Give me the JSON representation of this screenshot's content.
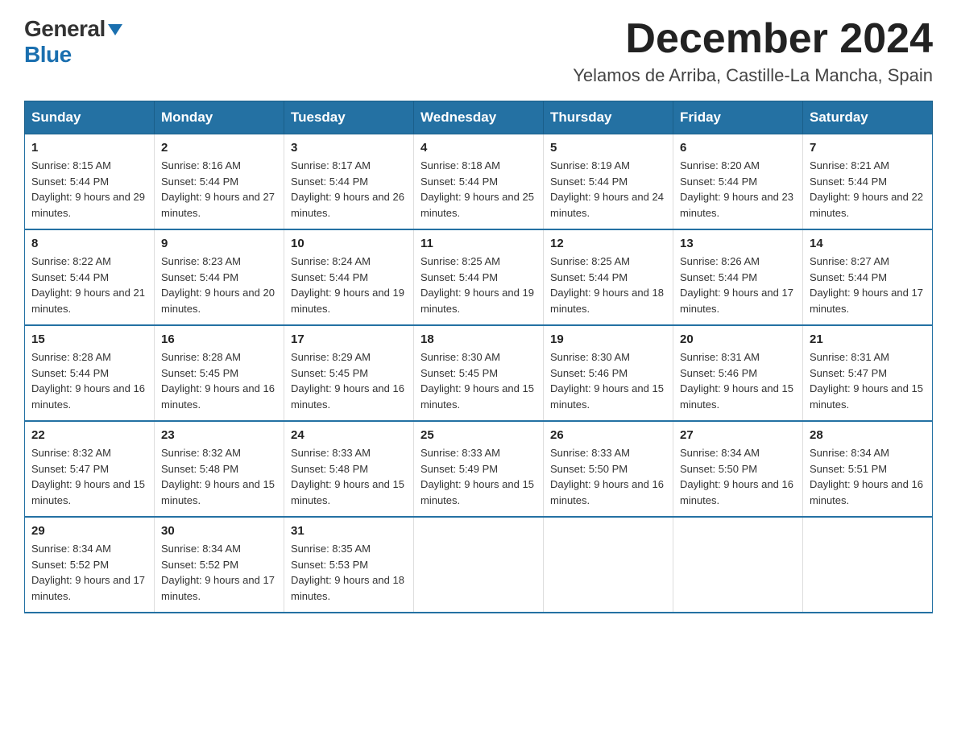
{
  "logo": {
    "general": "General",
    "blue": "Blue"
  },
  "title": "December 2024",
  "location": "Yelamos de Arriba, Castille-La Mancha, Spain",
  "days_of_week": [
    "Sunday",
    "Monday",
    "Tuesday",
    "Wednesday",
    "Thursday",
    "Friday",
    "Saturday"
  ],
  "weeks": [
    [
      {
        "day": "1",
        "sunrise": "8:15 AM",
        "sunset": "5:44 PM",
        "daylight": "9 hours and 29 minutes."
      },
      {
        "day": "2",
        "sunrise": "8:16 AM",
        "sunset": "5:44 PM",
        "daylight": "9 hours and 27 minutes."
      },
      {
        "day": "3",
        "sunrise": "8:17 AM",
        "sunset": "5:44 PM",
        "daylight": "9 hours and 26 minutes."
      },
      {
        "day": "4",
        "sunrise": "8:18 AM",
        "sunset": "5:44 PM",
        "daylight": "9 hours and 25 minutes."
      },
      {
        "day": "5",
        "sunrise": "8:19 AM",
        "sunset": "5:44 PM",
        "daylight": "9 hours and 24 minutes."
      },
      {
        "day": "6",
        "sunrise": "8:20 AM",
        "sunset": "5:44 PM",
        "daylight": "9 hours and 23 minutes."
      },
      {
        "day": "7",
        "sunrise": "8:21 AM",
        "sunset": "5:44 PM",
        "daylight": "9 hours and 22 minutes."
      }
    ],
    [
      {
        "day": "8",
        "sunrise": "8:22 AM",
        "sunset": "5:44 PM",
        "daylight": "9 hours and 21 minutes."
      },
      {
        "day": "9",
        "sunrise": "8:23 AM",
        "sunset": "5:44 PM",
        "daylight": "9 hours and 20 minutes."
      },
      {
        "day": "10",
        "sunrise": "8:24 AM",
        "sunset": "5:44 PM",
        "daylight": "9 hours and 19 minutes."
      },
      {
        "day": "11",
        "sunrise": "8:25 AM",
        "sunset": "5:44 PM",
        "daylight": "9 hours and 19 minutes."
      },
      {
        "day": "12",
        "sunrise": "8:25 AM",
        "sunset": "5:44 PM",
        "daylight": "9 hours and 18 minutes."
      },
      {
        "day": "13",
        "sunrise": "8:26 AM",
        "sunset": "5:44 PM",
        "daylight": "9 hours and 17 minutes."
      },
      {
        "day": "14",
        "sunrise": "8:27 AM",
        "sunset": "5:44 PM",
        "daylight": "9 hours and 17 minutes."
      }
    ],
    [
      {
        "day": "15",
        "sunrise": "8:28 AM",
        "sunset": "5:44 PM",
        "daylight": "9 hours and 16 minutes."
      },
      {
        "day": "16",
        "sunrise": "8:28 AM",
        "sunset": "5:45 PM",
        "daylight": "9 hours and 16 minutes."
      },
      {
        "day": "17",
        "sunrise": "8:29 AM",
        "sunset": "5:45 PM",
        "daylight": "9 hours and 16 minutes."
      },
      {
        "day": "18",
        "sunrise": "8:30 AM",
        "sunset": "5:45 PM",
        "daylight": "9 hours and 15 minutes."
      },
      {
        "day": "19",
        "sunrise": "8:30 AM",
        "sunset": "5:46 PM",
        "daylight": "9 hours and 15 minutes."
      },
      {
        "day": "20",
        "sunrise": "8:31 AM",
        "sunset": "5:46 PM",
        "daylight": "9 hours and 15 minutes."
      },
      {
        "day": "21",
        "sunrise": "8:31 AM",
        "sunset": "5:47 PM",
        "daylight": "9 hours and 15 minutes."
      }
    ],
    [
      {
        "day": "22",
        "sunrise": "8:32 AM",
        "sunset": "5:47 PM",
        "daylight": "9 hours and 15 minutes."
      },
      {
        "day": "23",
        "sunrise": "8:32 AM",
        "sunset": "5:48 PM",
        "daylight": "9 hours and 15 minutes."
      },
      {
        "day": "24",
        "sunrise": "8:33 AM",
        "sunset": "5:48 PM",
        "daylight": "9 hours and 15 minutes."
      },
      {
        "day": "25",
        "sunrise": "8:33 AM",
        "sunset": "5:49 PM",
        "daylight": "9 hours and 15 minutes."
      },
      {
        "day": "26",
        "sunrise": "8:33 AM",
        "sunset": "5:50 PM",
        "daylight": "9 hours and 16 minutes."
      },
      {
        "day": "27",
        "sunrise": "8:34 AM",
        "sunset": "5:50 PM",
        "daylight": "9 hours and 16 minutes."
      },
      {
        "day": "28",
        "sunrise": "8:34 AM",
        "sunset": "5:51 PM",
        "daylight": "9 hours and 16 minutes."
      }
    ],
    [
      {
        "day": "29",
        "sunrise": "8:34 AM",
        "sunset": "5:52 PM",
        "daylight": "9 hours and 17 minutes."
      },
      {
        "day": "30",
        "sunrise": "8:34 AM",
        "sunset": "5:52 PM",
        "daylight": "9 hours and 17 minutes."
      },
      {
        "day": "31",
        "sunrise": "8:35 AM",
        "sunset": "5:53 PM",
        "daylight": "9 hours and 18 minutes."
      },
      null,
      null,
      null,
      null
    ]
  ],
  "labels": {
    "sunrise_prefix": "Sunrise: ",
    "sunset_prefix": "Sunset: ",
    "daylight_prefix": "Daylight: "
  }
}
